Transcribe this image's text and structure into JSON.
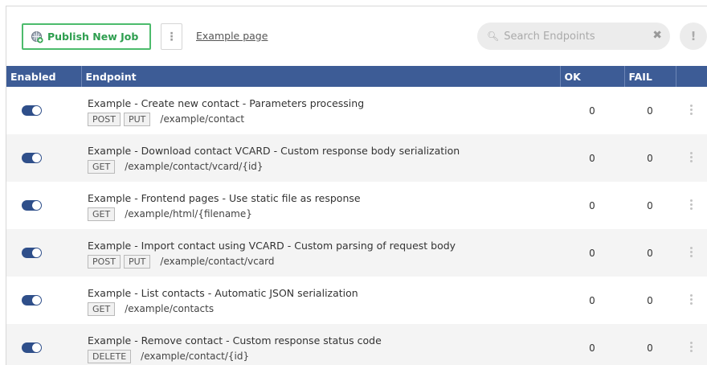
{
  "toolbar": {
    "publish_label": "Publish New Job",
    "menu_icon": "vertical-dots-icon",
    "example_link": "Example page",
    "search_placeholder": "Search Endpoints",
    "clear_label": "✖",
    "alert_label": "!"
  },
  "table": {
    "headers": [
      "Enabled",
      "Endpoint",
      "OK",
      "FAIL",
      ""
    ],
    "rows": [
      {
        "enabled": true,
        "title": "Example - Create new contact - Parameters processing",
        "methods": [
          "POST",
          "PUT"
        ],
        "path": "/example/contact",
        "ok": "0",
        "fail": "0"
      },
      {
        "enabled": true,
        "title": "Example - Download contact VCARD - Custom response body serialization",
        "methods": [
          "GET"
        ],
        "path": "/example/contact/vcard/{id}",
        "ok": "0",
        "fail": "0"
      },
      {
        "enabled": true,
        "title": "Example - Frontend pages - Use static file as response",
        "methods": [
          "GET"
        ],
        "path": "/example/html/{filename}",
        "ok": "0",
        "fail": "0"
      },
      {
        "enabled": true,
        "title": "Example - Import contact using VCARD - Custom parsing of request body",
        "methods": [
          "POST",
          "PUT"
        ],
        "path": "/example/contact/vcard",
        "ok": "0",
        "fail": "0"
      },
      {
        "enabled": true,
        "title": "Example - List contacts - Automatic JSON serialization",
        "methods": [
          "GET"
        ],
        "path": "/example/contacts",
        "ok": "0",
        "fail": "0"
      },
      {
        "enabled": true,
        "title": "Example - Remove contact - Custom response status code",
        "methods": [
          "DELETE"
        ],
        "path": "/example/contact/{id}",
        "ok": "0",
        "fail": "0"
      }
    ]
  },
  "colors": {
    "header_bg": "#3d5c96",
    "publish_green": "#4cbb6c",
    "toggle_on": "#2f4f8a"
  }
}
